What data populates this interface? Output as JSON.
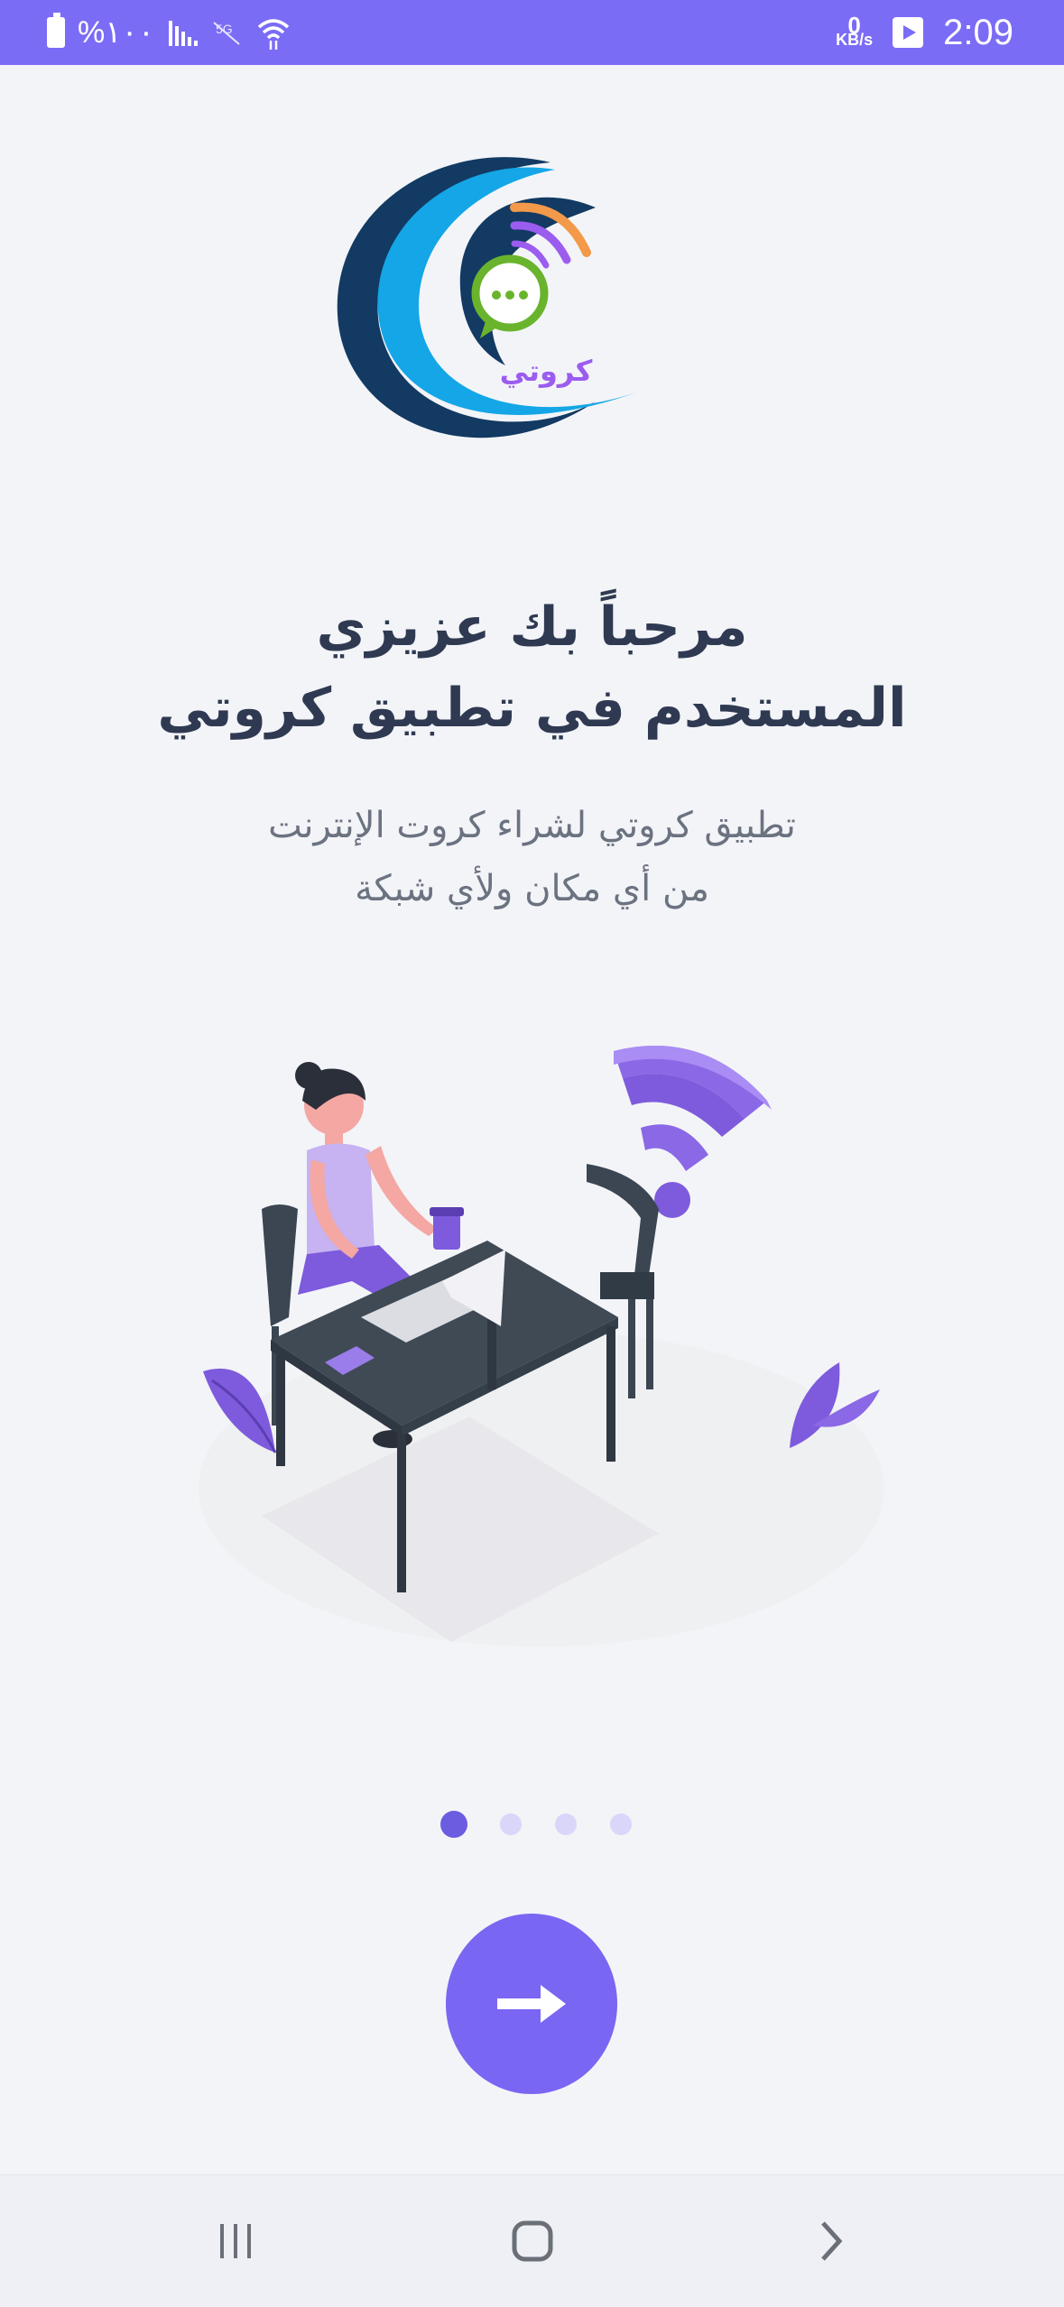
{
  "status_bar": {
    "battery_percent": "%١٠٠",
    "network_speed_value": "0",
    "network_speed_unit": "KB/s",
    "time": "2:09",
    "icons": [
      "battery-icon",
      "signal-icon",
      "no-signal-icon",
      "wifi-icon",
      "data-speed-icon",
      "play-store-icon"
    ]
  },
  "logo": {
    "brand_text": "كروتي",
    "colors": {
      "navy": "#123a63",
      "cyan": "#14a6e6",
      "green": "#69b42c",
      "orange": "#f2994a",
      "purple": "#9b5cf0"
    }
  },
  "onboarding": {
    "title_line1": "مرحباً بك عزيزي",
    "title_line2": "المستخدم في تطبيق كروتي",
    "description_line1": "تطبيق كروتي لشراء كروت الإنترنت",
    "description_line2": "من أي مكان ولأي شبكة",
    "illustration": "woman-at-laptop-with-wifi-illustration",
    "page_count": 4,
    "current_page": 1
  },
  "next_button": {
    "icon": "arrow-right-icon",
    "color": "#7966f2"
  },
  "nav_bar": {
    "items": [
      "recent-apps-icon",
      "home-icon",
      "back-icon"
    ]
  },
  "colors": {
    "accent": "#7b6cf6",
    "title": "#2f3a52",
    "subtitle": "#6b7280",
    "background": "#f3f4f8"
  }
}
